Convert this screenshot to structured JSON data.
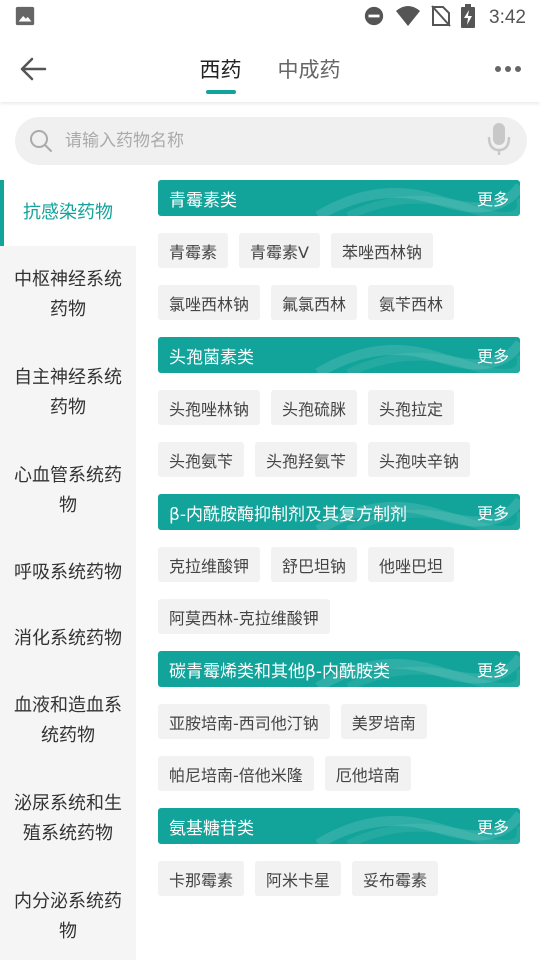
{
  "status_bar": {
    "time": "3:42",
    "icons": [
      "image-icon",
      "do-not-disturb-icon",
      "wifi-icon",
      "no-sim-icon",
      "battery-charging-icon"
    ]
  },
  "app_bar": {
    "tabs": [
      {
        "label": "西药",
        "active": true
      },
      {
        "label": "中成药",
        "active": false
      }
    ]
  },
  "search": {
    "placeholder": "请输入药物名称"
  },
  "sidebar": {
    "items": [
      {
        "label": "抗感染药物"
      },
      {
        "label": "中枢神经系统药物"
      },
      {
        "label": "自主神经系统药物"
      },
      {
        "label": "心血管系统药物"
      },
      {
        "label": "呼吸系统药物"
      },
      {
        "label": "消化系统药物"
      },
      {
        "label": "血液和造血系统药物"
      },
      {
        "label": "泌尿系统和生殖系统药物"
      },
      {
        "label": "内分泌系统药物"
      }
    ]
  },
  "sections": [
    {
      "title": "青霉素类",
      "more": "更多",
      "items": [
        "青霉素",
        "青霉素V",
        "苯唑西林钠",
        "氯唑西林钠",
        "氟氯西林",
        "氨苄西林"
      ]
    },
    {
      "title": "头孢菌素类",
      "more": "更多",
      "items": [
        "头孢唑林钠",
        "头孢硫脒",
        "头孢拉定",
        "头孢氨苄",
        "头孢羟氨苄",
        "头孢呋辛钠"
      ]
    },
    {
      "title": "β-内酰胺酶抑制剂及其复方制剂",
      "more": "更多",
      "items": [
        "克拉维酸钾",
        "舒巴坦钠",
        "他唑巴坦",
        "阿莫西林-克拉维酸钾"
      ]
    },
    {
      "title": "碳青霉烯类和其他β-内酰胺类",
      "more": "更多",
      "items": [
        "亚胺培南-西司他汀钠",
        "美罗培南",
        "帕尼培南-倍他米隆",
        "厄他培南"
      ]
    },
    {
      "title": "氨基糖苷类",
      "more": "更多",
      "items": [
        "卡那霉素",
        "阿米卡星",
        "妥布霉素"
      ]
    }
  ],
  "colors": {
    "accent": "#12a39a",
    "sidebar_bg": "#f5f5f5",
    "chip_bg": "#f2f2f2"
  }
}
